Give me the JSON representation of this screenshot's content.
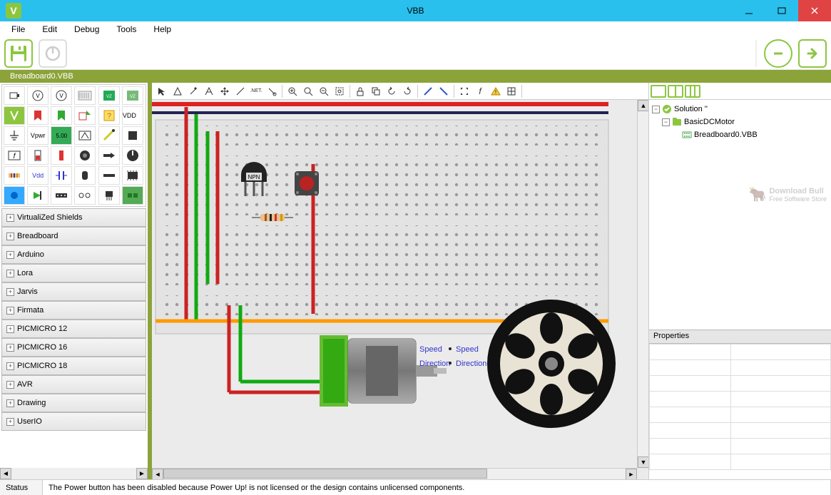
{
  "window": {
    "title": "VBB",
    "logo_letter": "V"
  },
  "menu": {
    "items": [
      "File",
      "Edit",
      "Debug",
      "Tools",
      "Help"
    ]
  },
  "main_toolbar": {
    "save_icon": "save-icon",
    "power_icon": "power-icon",
    "minus_icon": "minus-icon",
    "next_icon": "arrow-right-icon"
  },
  "tab": {
    "active": "Breadboard0.VBB"
  },
  "palette_labels": {
    "vpwr": "Vpwr",
    "vdd": "VDD",
    "vdd2": "Vdd",
    "net": ".NET.",
    "five": "5.00",
    "f": "f"
  },
  "categories": [
    "VirtualiZed Shields",
    "Breadboard",
    "Arduino",
    "Lora",
    "Jarvis",
    "Firmata",
    "PICMICRO 12",
    "PICMICRO 16",
    "PICMICRO 18",
    "AVR",
    "Drawing",
    "UserIO"
  ],
  "canvas_toolbar_icons": [
    "pointer",
    "triangle",
    "wand",
    "measure",
    "move",
    "line",
    "net-label",
    "attach",
    "sep",
    "zoom-in",
    "zoom-actual",
    "zoom-out",
    "zoom-fit",
    "sep",
    "lock",
    "stack",
    "rotate-ccw",
    "rotate-cw",
    "sep",
    "flip",
    "mirror",
    "sep",
    "expand",
    "f",
    "warning",
    "grid",
    "sep"
  ],
  "canvas": {
    "transistor_label": "NPN",
    "motor_labels": {
      "speed1": "Speed",
      "speed2": "Speed",
      "dir1": "Direction",
      "dir2": "Direction"
    }
  },
  "solution_tree": {
    "root": "Solution ''",
    "project": "BasicDCMotor",
    "file": "Breadboard0.VBB"
  },
  "watermark": {
    "line1": "Download Bull",
    "line2": "Free Software Store"
  },
  "properties": {
    "header": "Properties"
  },
  "statusbar": {
    "label": "Status",
    "message": "The Power button has been disabled because Power Up! is not licensed or the design contains unlicensed components."
  }
}
